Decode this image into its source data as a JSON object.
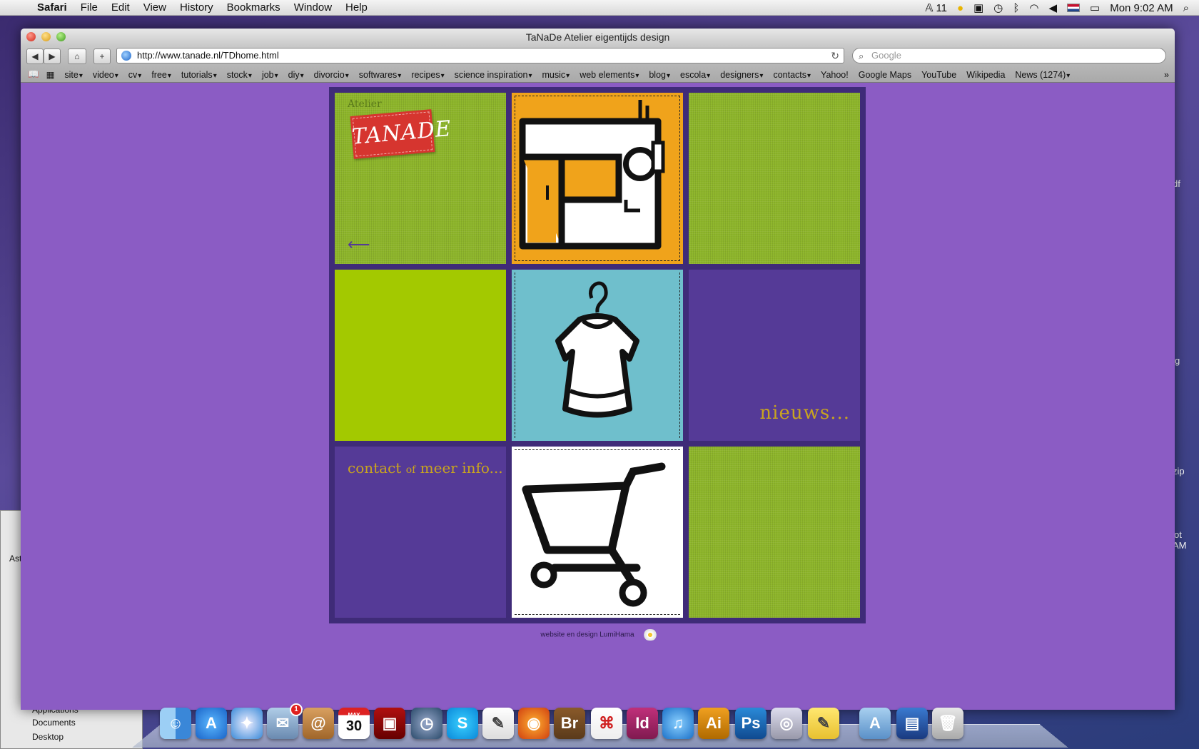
{
  "menubar": {
    "app": "Safari",
    "items": [
      "File",
      "Edit",
      "View",
      "History",
      "Bookmarks",
      "Window",
      "Help"
    ],
    "status_count": "11",
    "clock": "Mon 9:02 AM"
  },
  "desktop": {
    "side_labels": [
      "df",
      "g",
      "zip",
      "ot",
      "AM"
    ],
    "finder_rows": [
      "Applications",
      "Documents",
      "Desktop"
    ],
    "finder_header": "Ast"
  },
  "window": {
    "title": "TaNaDe Atelier eigentijds design",
    "url": "http://www.tanade.nl/TDhome.html",
    "search_placeholder": "Google"
  },
  "bookmarks": [
    {
      "label": "site",
      "dropdown": true
    },
    {
      "label": "video",
      "dropdown": true
    },
    {
      "label": "cv",
      "dropdown": true
    },
    {
      "label": "free",
      "dropdown": true
    },
    {
      "label": "tutorials",
      "dropdown": true
    },
    {
      "label": "stock",
      "dropdown": true
    },
    {
      "label": "job",
      "dropdown": true
    },
    {
      "label": "diy",
      "dropdown": true
    },
    {
      "label": "divorcio",
      "dropdown": true
    },
    {
      "label": "softwares",
      "dropdown": true
    },
    {
      "label": "recipes",
      "dropdown": true
    },
    {
      "label": "science inspiration",
      "dropdown": true
    },
    {
      "label": "music",
      "dropdown": true
    },
    {
      "label": "web elements",
      "dropdown": true
    },
    {
      "label": "blog",
      "dropdown": true
    },
    {
      "label": "escola",
      "dropdown": true
    },
    {
      "label": "designers",
      "dropdown": true
    },
    {
      "label": "contacts",
      "dropdown": true
    },
    {
      "label": "Yahoo!",
      "dropdown": false
    },
    {
      "label": "Google Maps",
      "dropdown": false
    },
    {
      "label": "YouTube",
      "dropdown": false
    },
    {
      "label": "Wikipedia",
      "dropdown": false
    },
    {
      "label": "News (1274)",
      "dropdown": true
    }
  ],
  "site": {
    "logo_small": "Atelier",
    "logo_main": "TANADE",
    "nieuws": "nieuws...",
    "contact_a": "contact ",
    "contact_of": "of",
    "contact_b": " meer info...",
    "credit": "website en design LumiHama",
    "colors": {
      "background": "#8b5cc4",
      "frame": "#3f2b78",
      "linen_green": "#8db52a",
      "lime": "#a3c900",
      "violet": "#553a97",
      "orange": "#f0a31b",
      "teal": "#6fbfcc",
      "gold_text": "#c9a41f"
    }
  },
  "dock": {
    "icons": [
      "finder-icon",
      "app-store-icon",
      "safari-icon",
      "mail-bird-icon",
      "address-book-icon",
      "ical-icon",
      "photo-booth-icon",
      "time-machine-icon",
      "skype-icon",
      "textedit-icon",
      "firefox-icon",
      "bridge-icon",
      "acrobat-icon",
      "indesign-icon",
      "itunes-icon",
      "illustrator-icon",
      "photoshop-icon",
      "preview-icon",
      "stickies-icon",
      "applications-folder-icon",
      "downloads-stack-icon",
      "trash-icon"
    ],
    "mail_badge": "1",
    "ical_day": "30",
    "ical_month": "MAY",
    "labels": {
      "bridge": "Br",
      "indesign": "Id",
      "illustrator": "Ai",
      "photoshop": "Ps"
    }
  }
}
